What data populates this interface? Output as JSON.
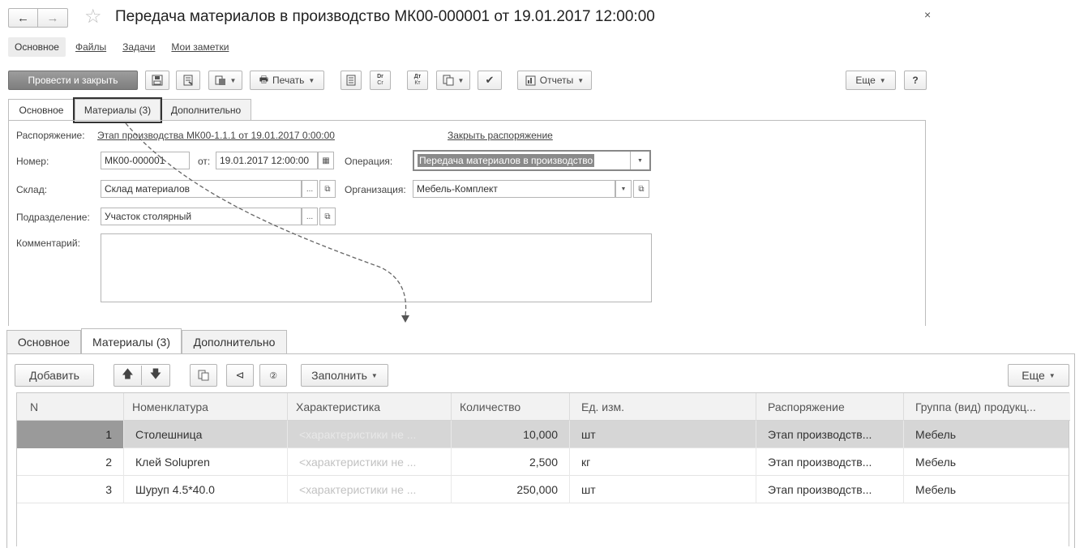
{
  "window": {
    "title": "Передача материалов в производство МК00-000001 от 19.01.2017 12:00:00"
  },
  "top_nav": {
    "items": [
      "Основное",
      "Файлы",
      "Задачи",
      "Мои заметки"
    ]
  },
  "toolbar": {
    "post_close": "Провести и закрыть",
    "print": "Печать",
    "dr_top": "Dr",
    "dr_bottom": "Cr",
    "at_top": "Дт",
    "at_bottom": "Кт",
    "reports": "Отчеты",
    "more": "Еще",
    "help": "?"
  },
  "form_tabs": [
    "Основное",
    "Материалы (3)",
    "Дополнительно"
  ],
  "form": {
    "order_label": "Распоряжение:",
    "order_link": "Этап производства МК00-1.1.1 от 19.01.2017 0:00:00",
    "close_order": "Закрыть распоряжение",
    "number_label": "Номер:",
    "number": "МК00-000001",
    "date_label": "от:",
    "date": "19.01.2017 12:00:00",
    "operation_label": "Операция:",
    "operation": "Передача материалов в производство",
    "warehouse_label": "Склад:",
    "warehouse": "Склад материалов",
    "org_label": "Организация:",
    "org": "Мебель-Комплект",
    "dept_label": "Подразделение:",
    "dept": "Участок столярный",
    "comment_label": "Комментарий:",
    "comment": "",
    "ellipsis": "..."
  },
  "detail_tabs": [
    "Основное",
    "Материалы (3)",
    "Дополнительно"
  ],
  "detail_toolbar": {
    "add": "Добавить",
    "fill": "Заполнить",
    "more": "Еще"
  },
  "table": {
    "columns": [
      "N",
      "Номенклатура",
      "Характеристика",
      "Количество",
      "Ед. изм.",
      "Распоряжение",
      "Группа (вид) продукц..."
    ],
    "rows": [
      {
        "n": "1",
        "item": "Столешница",
        "characteristic": "<характеристики не ...",
        "qty": "10,000",
        "unit": "шт",
        "order": "Этап производств...",
        "group": "Мебель"
      },
      {
        "n": "2",
        "item": "Клей Solupren",
        "characteristic": "<характеристики не ...",
        "qty": "2,500",
        "unit": "кг",
        "order": "Этап производств...",
        "group": "Мебель"
      },
      {
        "n": "3",
        "item": "Шуруп 4.5*40.0",
        "characteristic": "<характеристики не ...",
        "qty": "250,000",
        "unit": "шт",
        "order": "Этап производств...",
        "group": "Мебель"
      }
    ]
  },
  "icons": {
    "back": "arrow-left-icon",
    "forward": "arrow-right-icon",
    "favorite": "star-icon",
    "close": "close-icon",
    "save": "disk-icon",
    "calendar": "calendar-icon",
    "open": "open-window-icon"
  },
  "colors": {
    "primary_button": "#8a8a8a",
    "selected_row": "#d6d6d6",
    "selected_n": "#9a9a9a"
  }
}
